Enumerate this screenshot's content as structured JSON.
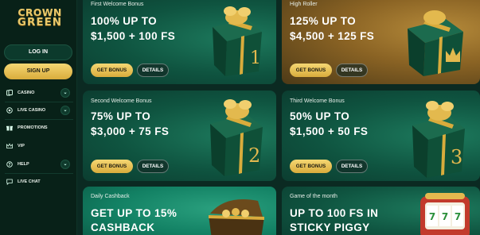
{
  "brand": {
    "logo_line1": "CROWN",
    "logo_line2": "GREEN"
  },
  "sidebar": {
    "login_label": "LOG IN",
    "signup_label": "SIGN UP",
    "items": [
      {
        "label": "CASINO",
        "icon": "cards-icon",
        "expandable": true
      },
      {
        "label": "LIVE CASINO",
        "icon": "chip-icon",
        "expandable": true
      },
      {
        "label": "PROMOTIONS",
        "icon": "gift-icon",
        "expandable": false
      },
      {
        "label": "VIP",
        "icon": "crown-icon",
        "expandable": false
      },
      {
        "label": "HELP",
        "icon": "help-icon",
        "expandable": true
      },
      {
        "label": "LIVE CHAT",
        "icon": "chat-icon",
        "expandable": false
      }
    ]
  },
  "promos": [
    {
      "label": "First Welcome Bonus",
      "title1": "100% UP TO",
      "title2": "$1,500 + 100 FS",
      "bonus": "GET BONUS",
      "details": "DETAILS",
      "badge": "1"
    },
    {
      "label": "High Roller",
      "title1": "125% UP TO",
      "title2": "$4,500 + 125 FS",
      "bonus": "GET BONUS",
      "details": "DETAILS",
      "badge": "crown"
    },
    {
      "label": "Second Welcome Bonus",
      "title1": "75% UP TO",
      "title2": "$3,000 + 75 FS",
      "bonus": "GET BONUS",
      "details": "DETAILS",
      "badge": "2"
    },
    {
      "label": "Third Welcome Bonus",
      "title1": "50% UP TO",
      "title2": "$1,500 + 50 FS",
      "bonus": "GET BONUS",
      "details": "DETAILS",
      "badge": "3"
    },
    {
      "label": "Daily Cashback",
      "title1": "GET UP TO 15%",
      "title2": "CASHBACK"
    },
    {
      "label": "Game of the month",
      "title1": "UP TO 100 FS IN",
      "title2": "STICKY PIGGY"
    }
  ],
  "colors": {
    "accent_gold": "#e3b94e",
    "card_green": "#0f5a45",
    "sidebar_bg": "#082118"
  }
}
